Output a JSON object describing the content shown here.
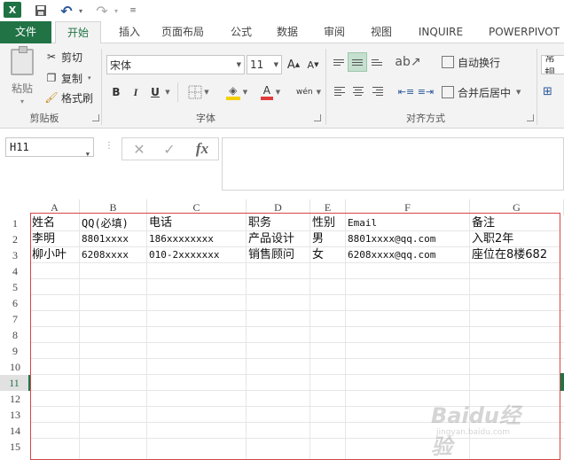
{
  "app": {
    "logo": "X"
  },
  "qat": {
    "undo": "↶",
    "redo": "↷",
    "save": "💾",
    "arrow": "▾",
    "customize": "≡"
  },
  "tabs": [
    {
      "label": "文件"
    },
    {
      "label": "开始"
    },
    {
      "label": "插入"
    },
    {
      "label": "页面布局"
    },
    {
      "label": "公式"
    },
    {
      "label": "数据"
    },
    {
      "label": "审阅"
    },
    {
      "label": "视图"
    },
    {
      "label": "INQUIRE"
    },
    {
      "label": "POWERPIVOT"
    }
  ],
  "ribbon": {
    "clipboard": {
      "paste": "粘贴",
      "cut": "剪切",
      "copy": "复制",
      "format_painter": "格式刷",
      "group_label": "剪贴板"
    },
    "font": {
      "name": "宋体",
      "size": "11",
      "grow": "A",
      "shrink": "A",
      "bold": "B",
      "italic": "I",
      "underline": "U",
      "font_color": "A",
      "phonetic": "wén",
      "group_label": "字体"
    },
    "alignment": {
      "wrap_text": "自动换行",
      "merge_center": "合并后居中",
      "group_label": "对齐方式"
    },
    "number": {
      "format": "常规"
    },
    "colors": {
      "accent": "#217346",
      "font_color_bar": "#e03b3b",
      "fill_color_bar": "#f5d000"
    }
  },
  "formula_bar": {
    "name_box": "H11",
    "cancel": "✕",
    "enter": "✓",
    "fx": "fx",
    "content": ""
  },
  "sheet": {
    "columns": [
      "A",
      "B",
      "C",
      "D",
      "E",
      "F",
      "G"
    ],
    "rows": [
      "1",
      "2",
      "3",
      "4",
      "5",
      "6",
      "7",
      "8",
      "9",
      "10",
      "11",
      "12",
      "13",
      "14",
      "15"
    ],
    "active_row": "11",
    "data": [
      [
        "姓名",
        "QQ(必填)",
        "电话",
        "职务",
        "性别",
        "Email",
        "备注"
      ],
      [
        "李明",
        "8801xxxx",
        "186xxxxxxxx",
        "产品设计",
        "男",
        "8801xxxx@qq.com",
        "入职2年"
      ],
      [
        "柳小叶",
        "6208xxxx",
        "010-2xxxxxxx",
        "销售顾问",
        "女",
        "6208xxxx@qq.com",
        "座位在8楼682"
      ]
    ],
    "highlight_border_color": "#d64545"
  },
  "watermark": {
    "brand": "Baidu经验",
    "sub": "jingyan.baidu.com"
  }
}
